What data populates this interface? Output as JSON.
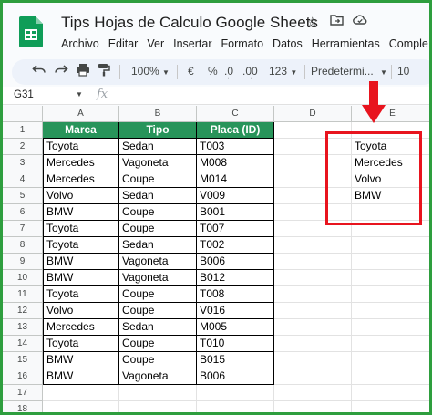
{
  "window": {
    "title": "Tips Hojas de Calculo Google Sheets"
  },
  "menu": [
    "Archivo",
    "Editar",
    "Ver",
    "Insertar",
    "Formato",
    "Datos",
    "Herramientas",
    "Comple"
  ],
  "toolbar": {
    "zoom": "100%",
    "currency": "€",
    "percent": "%",
    "dec_decrease": ".0",
    "dec_increase": ".00",
    "number_format": "123",
    "font": "Predetermi...",
    "font_size": "10"
  },
  "formula_bar": {
    "name_box": "G31",
    "fx": "fx"
  },
  "columns": [
    "A",
    "B",
    "C",
    "D",
    "E"
  ],
  "rows": [
    "1",
    "2",
    "3",
    "4",
    "5",
    "6",
    "7",
    "8",
    "9",
    "10",
    "11",
    "12",
    "13",
    "14",
    "15",
    "16",
    "17",
    "18"
  ],
  "table": {
    "headers": [
      "Marca",
      "Tipo",
      "Placa (ID)"
    ],
    "rows": [
      [
        "Toyota",
        "Sedan",
        "T003"
      ],
      [
        "Mercedes",
        "Vagoneta",
        "M008"
      ],
      [
        "Mercedes",
        "Coupe",
        "M014"
      ],
      [
        "Volvo",
        "Sedan",
        "V009"
      ],
      [
        "BMW",
        "Coupe",
        "B001"
      ],
      [
        "Toyota",
        "Coupe",
        "T007"
      ],
      [
        "Toyota",
        "Sedan",
        "T002"
      ],
      [
        "BMW",
        "Vagoneta",
        "B006"
      ],
      [
        "BMW",
        "Vagoneta",
        "B012"
      ],
      [
        "Toyota",
        "Coupe",
        "T008"
      ],
      [
        "Volvo",
        "Coupe",
        "V016"
      ],
      [
        "Mercedes",
        "Sedan",
        "M005"
      ],
      [
        "Toyota",
        "Coupe",
        "T010"
      ],
      [
        "BMW",
        "Coupe",
        "B015"
      ],
      [
        "BMW",
        "Vagoneta",
        "B006"
      ]
    ]
  },
  "unique_list": [
    "Toyota",
    "Mercedes",
    "Volvo",
    "BMW"
  ],
  "colors": {
    "header_fill": "#28945a",
    "highlight": "#e8141e",
    "frame": "#2e9e3e"
  }
}
